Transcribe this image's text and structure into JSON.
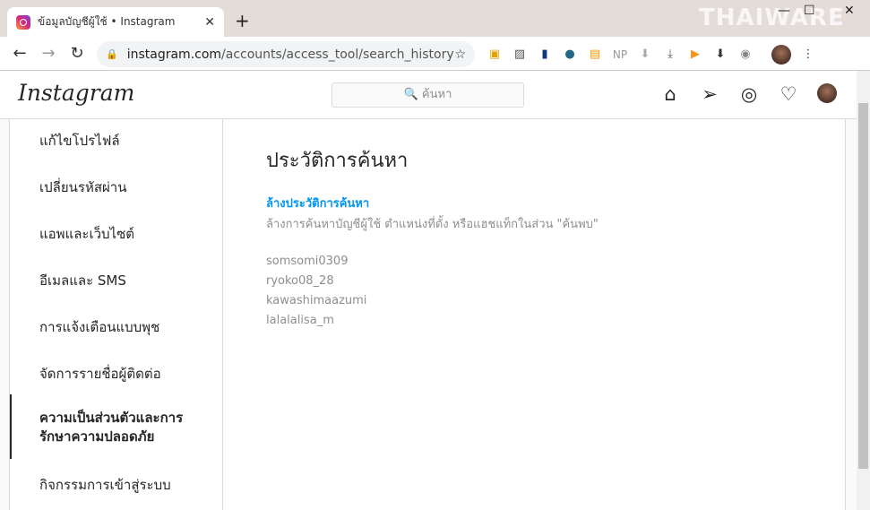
{
  "browser": {
    "tab_title": "ข้อมูลบัญชีผู้ใช้ • Instagram",
    "url_host": "instagram.com",
    "url_path": "/accounts/access_tool/search_history",
    "watermark": "THAIWARE",
    "ext_np": "NP"
  },
  "header": {
    "logo": "Instagram",
    "search_placeholder": "🔍 ค้นหา"
  },
  "sidebar": {
    "items": [
      {
        "label": "แก้ไขโปรไฟล์"
      },
      {
        "label": "เปลี่ยนรหัสผ่าน"
      },
      {
        "label": "แอพและเว็บไซต์"
      },
      {
        "label": "อีเมลและ SMS"
      },
      {
        "label": "การแจ้งเตือนแบบพุช"
      },
      {
        "label": "จัดการรายชื่อผู้ติดต่อ"
      },
      {
        "label": "ความเป็นส่วนตัวและการรักษาความปลอดภัย"
      },
      {
        "label": "กิจกรรมการเข้าสู่ระบบ"
      }
    ]
  },
  "main": {
    "title": "ประวัติการค้นหา",
    "clear_label": "ล้างประวัติการค้นหา",
    "clear_desc": "ล้างการค้นหาบัญชีผู้ใช้ ตำแหน่งที่ตั้ง หรือแฮชแท็กในส่วน \"ค้นพบ\"",
    "history": [
      "somsomi0309",
      "ryoko08_28",
      "kawashimaazumi",
      "lalalalisa_m"
    ]
  }
}
